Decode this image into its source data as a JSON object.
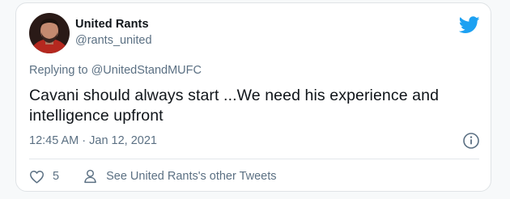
{
  "tweet": {
    "author_name": "United Rants",
    "author_handle": "@rants_united",
    "replying_prefix": "Replying to",
    "replying_to": "@UnitedStandMUFC",
    "text": "Cavani should always start ...We need his experience and intelligence upfront",
    "timestamp": "12:45 AM · Jan 12, 2021",
    "like_count": "5",
    "profile_link_text": "See United Rants's other Tweets"
  },
  "icons": {
    "brand": "twitter-bird-icon",
    "info": "info-icon",
    "like": "heart-icon",
    "profile": "person-icon"
  },
  "colors": {
    "brand_blue": "#1da1f2",
    "text_primary": "#0f1419",
    "text_secondary": "#5b7083"
  }
}
